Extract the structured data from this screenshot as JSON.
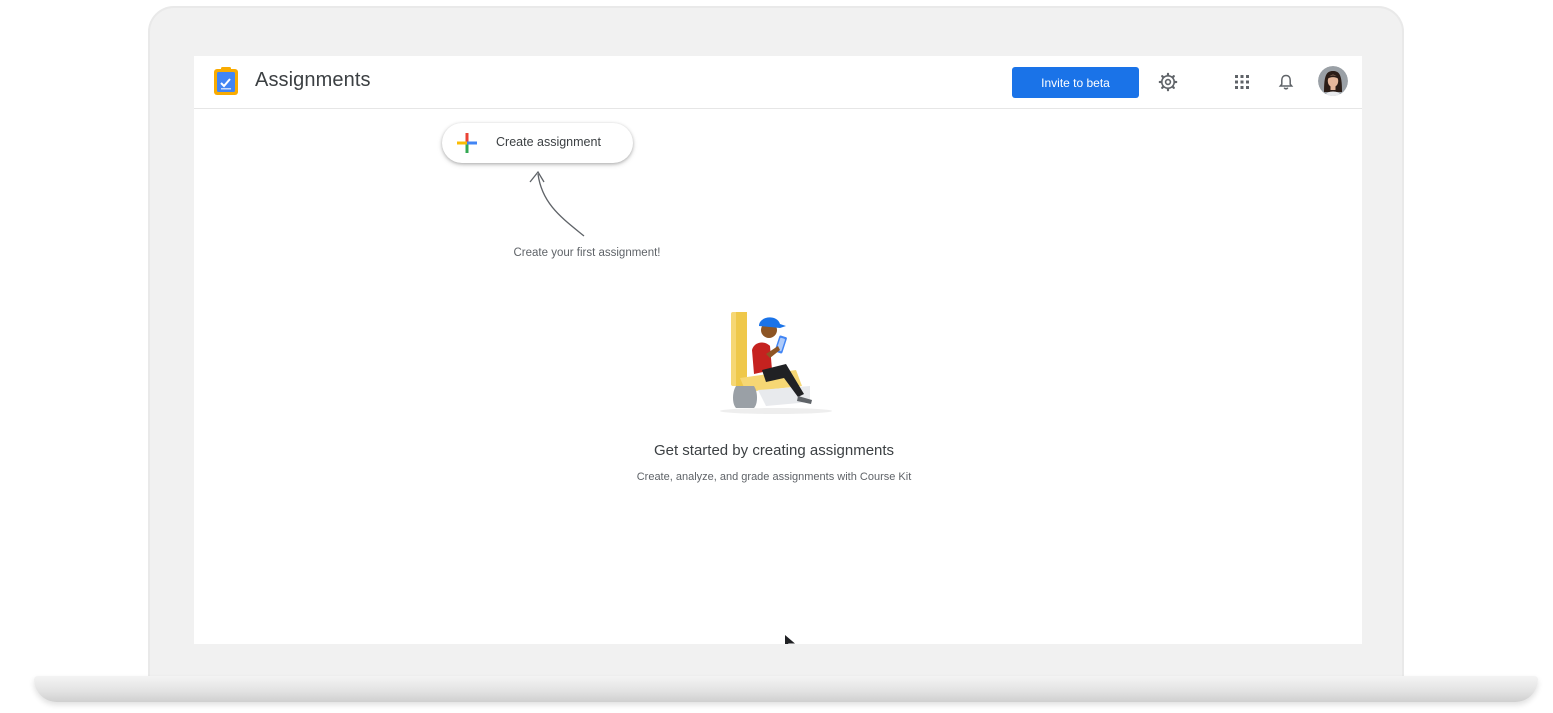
{
  "app": {
    "title": "Assignments",
    "logo_icon": "clipboard-assignment-icon"
  },
  "header": {
    "invite_label": "Invite to beta",
    "settings_icon": "gear-icon",
    "apps_icon": "apps-grid-icon",
    "notifications_icon": "bell-icon",
    "avatar_icon": "user-avatar"
  },
  "create": {
    "label": "Create assignment",
    "icon": "plus-icon"
  },
  "hint": {
    "text": "Create your first assignment!"
  },
  "empty_state": {
    "title": "Get started by creating assignments",
    "subtitle": "Create, analyze, and grade assignments with Course Kit"
  },
  "colors": {
    "primary": "#1a73e8",
    "text": "#3c4043",
    "muted": "#5f6368",
    "google_red": "#ea4335",
    "google_yellow": "#fbbc04",
    "google_green": "#34a853",
    "google_blue": "#4285f4"
  }
}
